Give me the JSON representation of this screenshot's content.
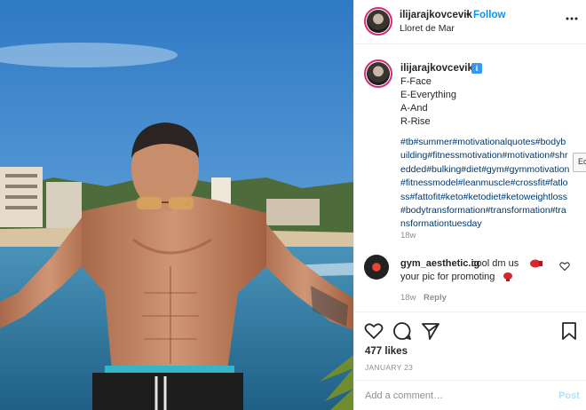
{
  "header": {
    "username": "ilijarajkovcevik",
    "dot": "•",
    "follow_label": "Follow",
    "location": "Lloret de Mar"
  },
  "caption": {
    "username": "ilijarajkovcevik",
    "verified_glyph": "i",
    "lines": [
      "F-Face",
      "E-Everything",
      "A-And",
      "R-Rise"
    ],
    "hashtags": "#tb#summer#motivationalquotes#bodybuilding#fitnessmotivation#motivation#shredded#bulking#diet#gym#gymmotivation#fitnessmodel#leanmuscle#crossfit#fatloss#fattofit#keto#ketodiet#ketoweightloss#bodytransformation#transformation#transformationtuesday",
    "time": "18w"
  },
  "comment": {
    "username": "gym_aesthetic.ig",
    "text1": "cool dm us",
    "text2": "your pic for promoting",
    "time": "18w",
    "reply_label": "Reply"
  },
  "actions": {
    "likes": "477 likes",
    "date": "JANUARY 23"
  },
  "add_comment": {
    "placeholder": "Add a comment…",
    "post_label": "Post"
  },
  "side_tab_label": "Ec",
  "icons": [
    "more-icon",
    "verified-icon",
    "heart-icon",
    "comment-icon",
    "share-icon",
    "bookmark-icon",
    "boxing-glove-icon"
  ],
  "colors": {
    "link_blue": "#0095f6",
    "hashtag": "#00376b",
    "muted": "#8e8e8e",
    "post_disabled": "#b2dffc"
  }
}
